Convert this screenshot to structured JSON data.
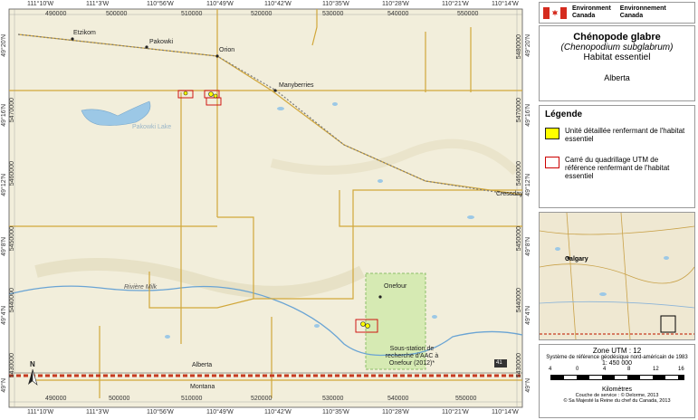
{
  "header": {
    "agency_en": "Environment",
    "agency_en2": "Canada",
    "agency_fr": "Environnement",
    "agency_fr2": "Canada"
  },
  "title": {
    "common_name": "Chénopode glabre",
    "latin_name": "(Chenopodium subglabrum)",
    "subtitle": "Habitat essentiel",
    "province": "Alberta"
  },
  "legend": {
    "heading": "Légende",
    "items": [
      {
        "label": "Unité détaillée renfermant de l'habitat essentiel",
        "color": "#ffff00",
        "border": "#222222"
      },
      {
        "label": "Carré du quadrillage UTM de référence renfermant de l'habitat essentiel",
        "color": "#ffffff",
        "border": "#cc0000"
      }
    ]
  },
  "inset": {
    "label": "Calgary"
  },
  "scale": {
    "zone": "Zone UTM : 12",
    "datum": "Système de référence géodésique nord-américain de 1983",
    "ratio": "1: 450 000",
    "ticks": [
      "4",
      "0",
      "16"
    ],
    "ticks_mid": [
      "4",
      "8",
      "12"
    ],
    "unit": "Kilomètres",
    "credits1": "Couche de service : © Delorme, 2013",
    "credits2": "© Sa Majesté la Reine du chef du Canada, 2013"
  },
  "map": {
    "places": {
      "etzikom": "Etzikom",
      "pakowki": "Pakowki",
      "orion": "Orion",
      "manyberries": "Manyberries",
      "pakowki_lake": "Pakowki Lake",
      "cressday": "Cressday",
      "riviere_milk": "Rivière Milk",
      "onefour": "Onefour",
      "sous_station": "Sous-station de recherche d'AAC à Onefour (2012)*",
      "alberta": "Alberta",
      "montana": "Montana",
      "hwy": "41",
      "north": "N"
    },
    "top_lon": [
      "111°10'W",
      "111°3'W",
      "110°56'W",
      "110°49'W",
      "110°42'W",
      "110°35'W",
      "110°28'W",
      "110°21'W",
      "110°14'W"
    ],
    "top_utm": [
      "490000",
      "500000",
      "510000",
      "520000",
      "530000",
      "540000",
      "550000"
    ],
    "bottom_lon": [
      "111°10'W",
      "111°3'W",
      "110°56'W",
      "110°49'W",
      "110°42'W",
      "110°35'W",
      "110°28'W",
      "110°21'W",
      "110°14'W"
    ],
    "bottom_utm": [
      "490000",
      "500000",
      "510000",
      "520000",
      "530000",
      "540000",
      "550000"
    ],
    "left_lat": [
      "49°20'N",
      "49°16'N",
      "49°12'N",
      "49°8'N",
      "49°4'N",
      "49°N"
    ],
    "left_utm": [
      "5470000",
      "5460000",
      "5450000",
      "5440000",
      "5430000"
    ],
    "right_utm": [
      "5480000",
      "5470000",
      "5460000",
      "5450000",
      "5440000",
      "5430000"
    ],
    "right_lat": [
      "49°20'N",
      "49°16'N",
      "49°12'N",
      "49°8'N",
      "49°4'N",
      "49°N"
    ]
  }
}
